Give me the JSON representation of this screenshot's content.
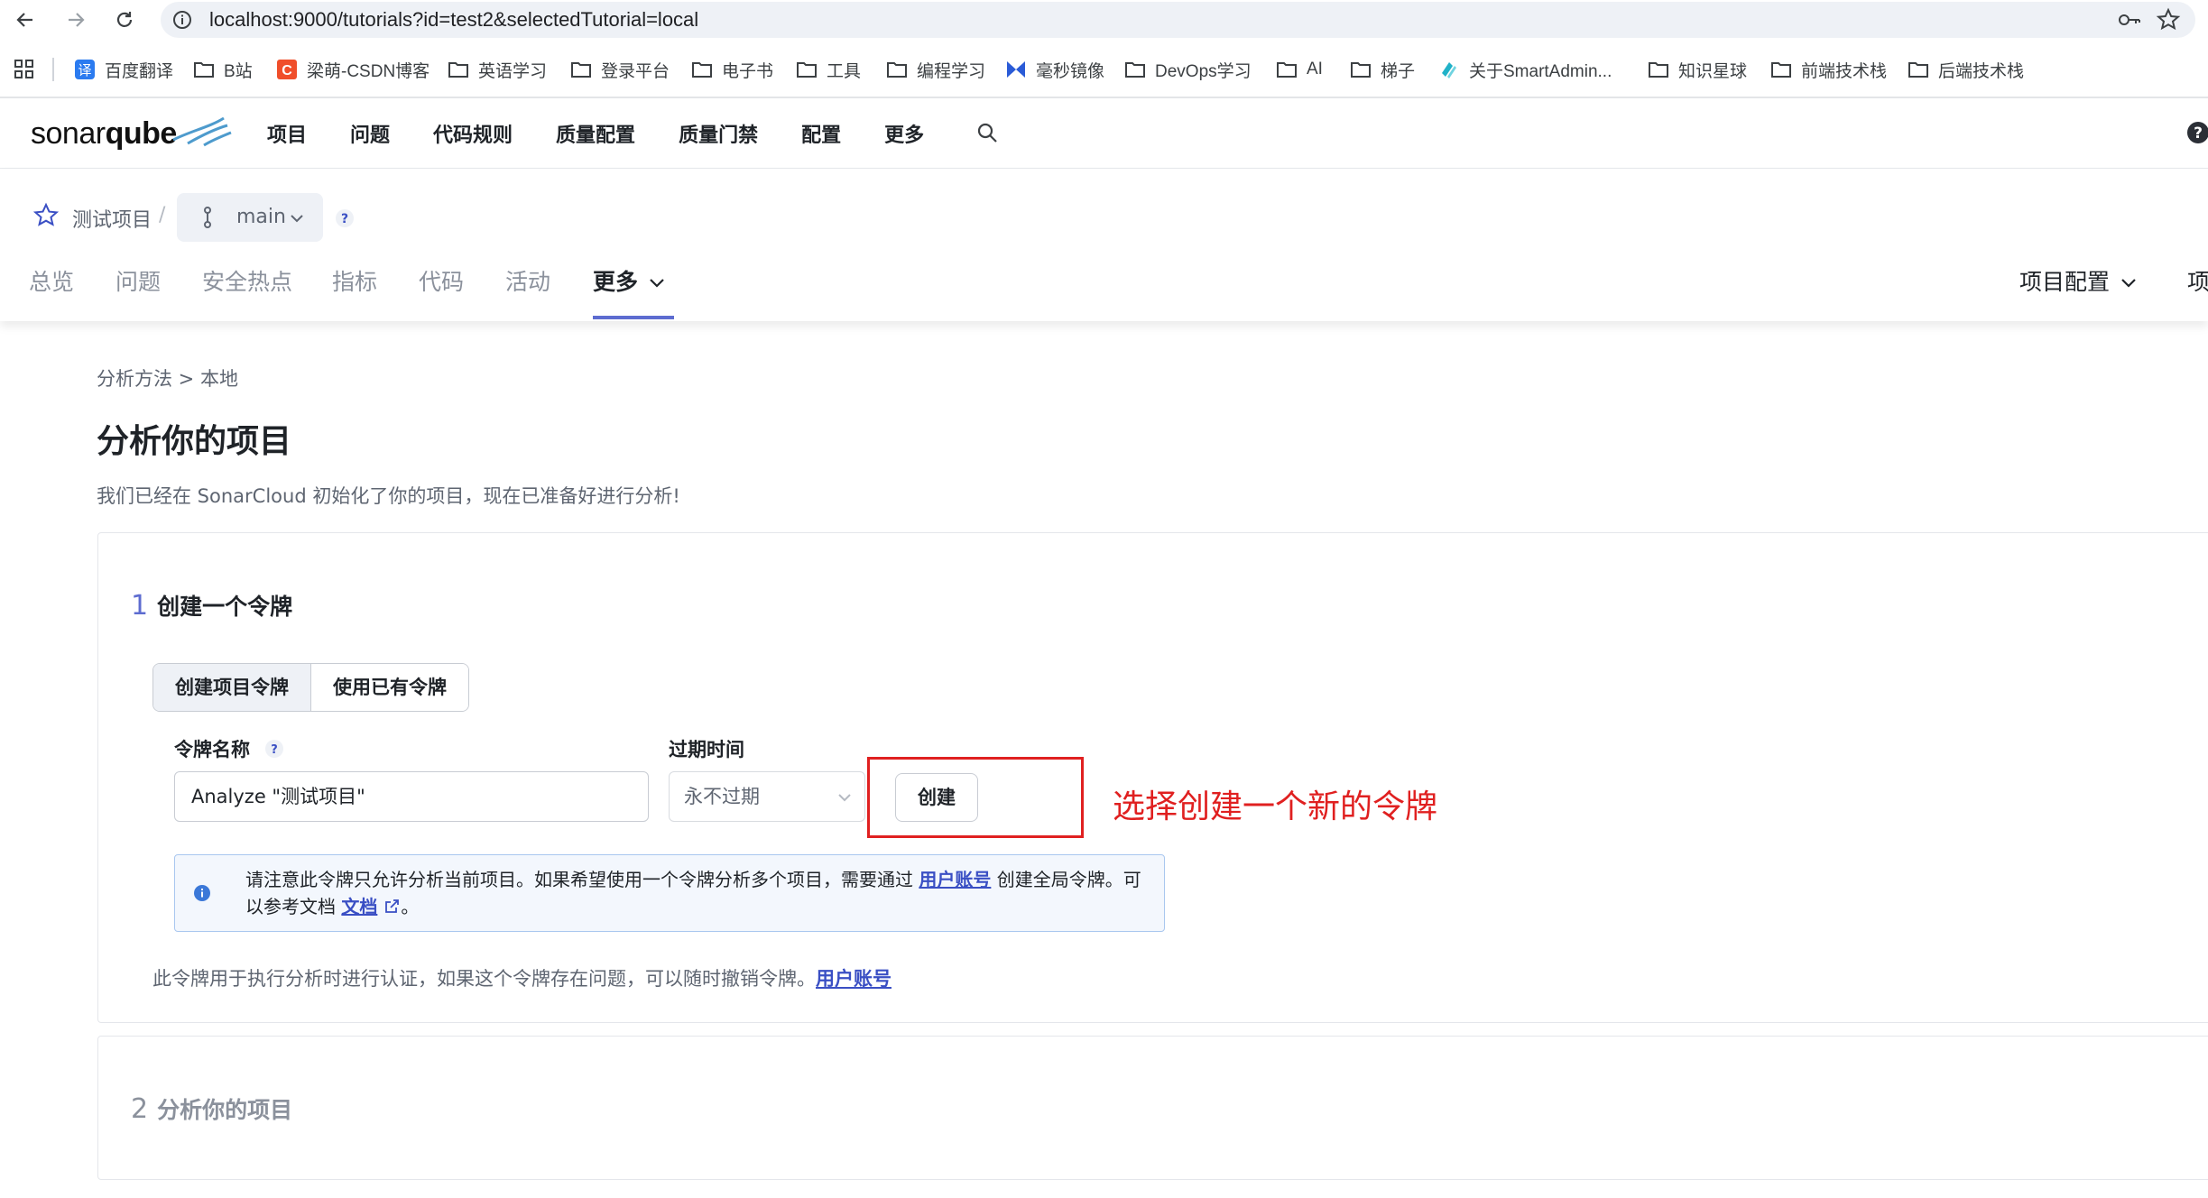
{
  "browser": {
    "url": "localhost:9000/tutorials?id=test2&selectedTutorial=local",
    "bookmarks": [
      {
        "label": "百度翻译",
        "icon": "translate-icon"
      },
      {
        "label": "B站",
        "icon": "folder-icon"
      },
      {
        "label": "梁萌-CSDN博客",
        "icon": "csdn-icon"
      },
      {
        "label": "英语学习",
        "icon": "folder-icon"
      },
      {
        "label": "登录平台",
        "icon": "folder-icon"
      },
      {
        "label": "电子书",
        "icon": "folder-icon"
      },
      {
        "label": "工具",
        "icon": "folder-icon"
      },
      {
        "label": "编程学习",
        "icon": "folder-icon"
      },
      {
        "label": "毫秒镜像",
        "icon": "mirror-icon"
      },
      {
        "label": "DevOps学习",
        "icon": "folder-icon"
      },
      {
        "label": "AI",
        "icon": "folder-icon"
      },
      {
        "label": "梯子",
        "icon": "folder-icon"
      },
      {
        "label": "关于SmartAdmin...",
        "icon": "smartadmin-icon"
      },
      {
        "label": "知识星球",
        "icon": "folder-icon"
      },
      {
        "label": "前端技术栈",
        "icon": "folder-icon"
      },
      {
        "label": "后端技术栈",
        "icon": "folder-icon"
      }
    ]
  },
  "header": {
    "logo_plain": "sonar",
    "logo_bold": "qube",
    "nav": [
      "项目",
      "问题",
      "代码规则",
      "质量配置",
      "质量门禁",
      "配置",
      "更多"
    ]
  },
  "project": {
    "name": "测试项目",
    "separator": "/",
    "branch": "main",
    "help": "?",
    "tabs": [
      "总览",
      "问题",
      "安全热点",
      "指标",
      "代码",
      "活动",
      "更多"
    ],
    "right_tabs": [
      "项目配置",
      "项"
    ]
  },
  "content": {
    "breadcrumb": "分析方法 > 本地",
    "title": "分析你的项目",
    "subtitle": "我们已经在 SonarCloud 初始化了你的项目，现在已准备好进行分析!",
    "step1": {
      "num": "1",
      "title": "创建一个令牌",
      "options": [
        "创建项目令牌",
        "使用已有令牌"
      ],
      "name_label": "令牌名称",
      "name_value": "Analyze \"测试项目\"",
      "expiry_label": "过期时间",
      "expiry_value": "永不过期",
      "create_label": "创建",
      "info_part1": "请注意此令牌只允许分析当前项目。如果希望使用一个令牌分析多个项目，需要通过",
      "info_link1": "用户账号",
      "info_part2": "创建全局令牌。可以参考文档",
      "info_link2": "文档",
      "info_part3": "。",
      "note": "此令牌用于执行分析时进行认证，如果这个令牌存在问题，可以随时撤销令牌。",
      "note_link": "用户账号"
    },
    "step2": {
      "num": "2",
      "title": "分析你的项目"
    },
    "annotation": "选择创建一个新的令牌"
  },
  "colors": {
    "accent": "#5d6cd0",
    "annotation": "#e02020",
    "link": "#3a4fc4",
    "info_bg": "#f3f7fd"
  }
}
